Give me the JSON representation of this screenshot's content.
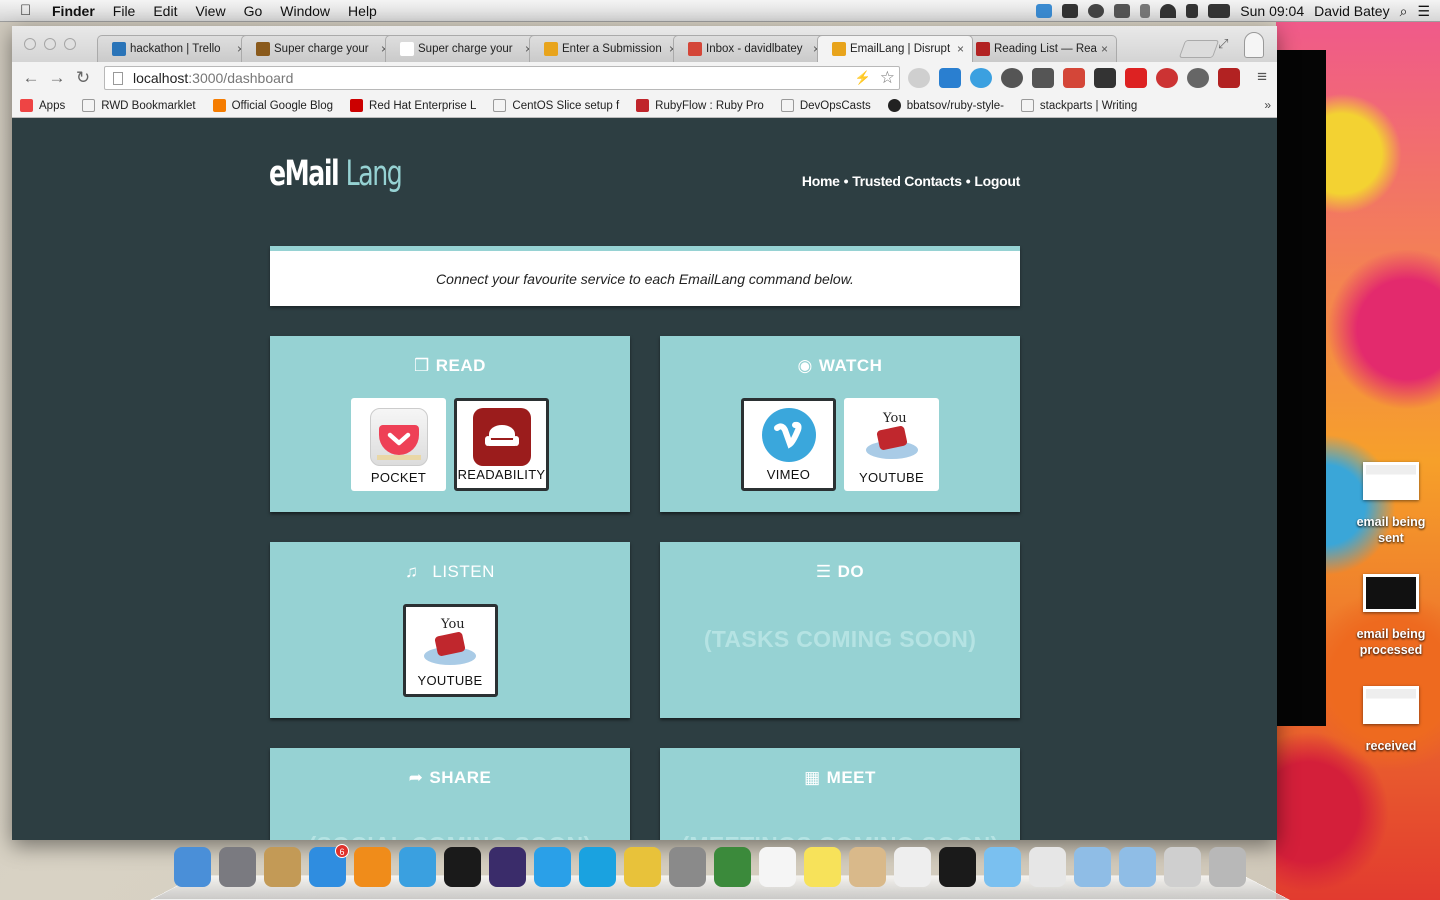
{
  "menubar": {
    "app_name": "Finder",
    "menus": [
      "File",
      "Edit",
      "View",
      "Go",
      "Window",
      "Help"
    ],
    "clock": "Sun 09:04",
    "user": "David Batey"
  },
  "browser": {
    "tabs": [
      {
        "title": "hackathon | Trello",
        "favicon_color": "#2a74b8"
      },
      {
        "title": "Super charge your",
        "favicon_color": "#8a5a1c"
      },
      {
        "title": "Super charge your",
        "favicon_color": "#ffffff"
      },
      {
        "title": "Enter a Submission",
        "favicon_color": "#e8a41c"
      },
      {
        "title": "Inbox - davidlbatey",
        "favicon_color": "#d44638"
      },
      {
        "title": "EmailLang | Disrupt",
        "favicon_color": "#e8a41c"
      },
      {
        "title": "Reading List — Rea",
        "favicon_color": "#b22222"
      }
    ],
    "address": {
      "host": "localhost",
      "path": ":3000/dashboard"
    },
    "bookmarks": [
      {
        "label": "Apps",
        "color": "#e44"
      },
      {
        "label": "RWD Bookmarklet",
        "color": "#ffffff"
      },
      {
        "label": "Official Google Blog",
        "color": "#f57c00"
      },
      {
        "label": "Red Hat Enterprise L",
        "color": "#c00"
      },
      {
        "label": "CentOS Slice setup f",
        "color": "#ffffff"
      },
      {
        "label": "RubyFlow : Ruby Pro",
        "color": "#c0252b"
      },
      {
        "label": "DevOpsCasts",
        "color": "#ffffff"
      },
      {
        "label": "bbatsov/ruby-style-",
        "color": "#222222"
      },
      {
        "label": "stackparts | Writing",
        "color": "#ffffff"
      }
    ],
    "bookmarks_more": "»"
  },
  "app": {
    "logo_part1": "eMail",
    "logo_part2": "Lang",
    "nav": {
      "home": "Home",
      "contacts": "Trusted Contacts",
      "logout": "Logout",
      "separator": "•"
    },
    "intro": "Connect your favourite service to each EmailLang command below.",
    "cards": {
      "read": {
        "icon": "❒",
        "title": "READ",
        "services": [
          {
            "label": "POCKET",
            "selected": false
          },
          {
            "label": "READABILITY",
            "selected": true
          }
        ]
      },
      "watch": {
        "icon": "◉",
        "title": "WATCH",
        "services": [
          {
            "label": "VIMEO",
            "selected": true
          },
          {
            "label": "YOUTUBE",
            "selected": false
          }
        ]
      },
      "listen": {
        "icon": "♫",
        "title": "LISTEN",
        "services": [
          {
            "label": "YOUTUBE",
            "selected": true
          }
        ]
      },
      "do": {
        "icon": "☰",
        "title": "DO",
        "soon": "(TASKS COMING SOON)"
      },
      "share": {
        "icon": "➦",
        "title": "SHARE",
        "soon": "(SOCIAL COMING SOON)"
      },
      "meet": {
        "icon": "▦",
        "title": "MEET",
        "soon": "(MEETINGS COMING SOON)"
      }
    },
    "colors": {
      "background": "#2d3e42",
      "card": "#96d2d3",
      "white": "#ffffff"
    }
  },
  "desktop": {
    "items": [
      {
        "label": "email being sent"
      },
      {
        "label": "email being processed"
      },
      {
        "label": "received"
      }
    ]
  },
  "dock": {
    "apps": [
      {
        "name": "finder-icon",
        "color": "#4a8fd8"
      },
      {
        "name": "launchpad-icon",
        "color": "#7a7a80"
      },
      {
        "name": "mail-bird-icon",
        "color": "#c39a56"
      },
      {
        "name": "app-store-icon",
        "color": "#2f8de0",
        "badge": "6"
      },
      {
        "name": "ibooks-icon",
        "color": "#f08c1a"
      },
      {
        "name": "safari-icon",
        "color": "#3aa0e0"
      },
      {
        "name": "spotify-icon",
        "color": "#1a1a1a"
      },
      {
        "name": "eclipse-icon",
        "color": "#3a2c6a"
      },
      {
        "name": "twitter-icon",
        "color": "#2aa0e8"
      },
      {
        "name": "skype-icon",
        "color": "#1aa2e0"
      },
      {
        "name": "chrome-icon",
        "color": "#e8c23a"
      },
      {
        "name": "system-preferences-icon",
        "color": "#8a8a8a"
      },
      {
        "name": "textmate-icon",
        "color": "#3b8a3b"
      },
      {
        "name": "text-file-icon",
        "color": "#f5f5f5"
      },
      {
        "name": "stickies-icon",
        "color": "#f7e25a"
      },
      {
        "name": "preview-icon",
        "color": "#d9b98a"
      },
      {
        "name": "todo-icon",
        "color": "#eeeeee"
      },
      {
        "name": "terminal-icon",
        "color": "#1a1a1a"
      },
      {
        "name": "messages-icon",
        "color": "#7ac0f0"
      },
      {
        "name": "x11-icon",
        "color": "#e6e6e6"
      },
      {
        "name": "folder-icon",
        "color": "#8fbde6"
      },
      {
        "name": "downloads-folder-icon",
        "color": "#8fbde6"
      },
      {
        "name": "screenshot-stack-icon",
        "color": "#cfcfcf"
      },
      {
        "name": "trash-icon",
        "color": "#b8b8b8"
      }
    ]
  }
}
